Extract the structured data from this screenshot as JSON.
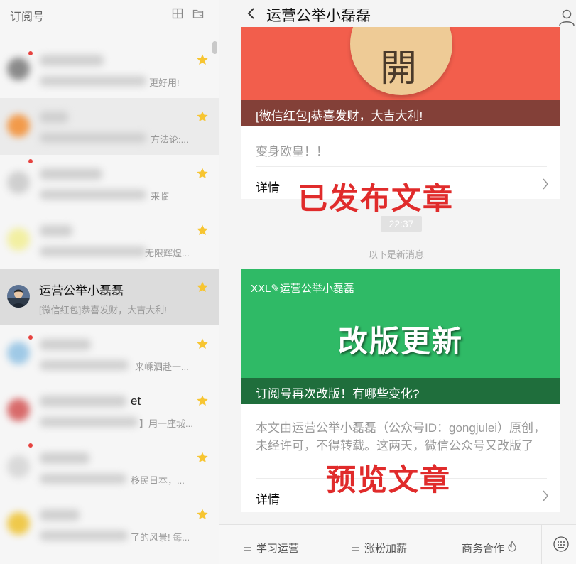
{
  "sidebar": {
    "title": "订阅号",
    "icons": [
      "grid-icon",
      "folder-icon"
    ],
    "items": [
      {
        "preview_tail": "更好用!"
      },
      {
        "preview_tail": "方法论:..."
      },
      {
        "preview_tail": "来临"
      },
      {
        "preview_tail": "无限辉煌..."
      },
      {
        "name": "运营公举小磊磊",
        "preview": "[微信红包]恭喜发财，大吉大利!"
      },
      {
        "preview_tail": "来嵊泗赴一..."
      },
      {
        "name_tail": "et",
        "preview_tail": "】用一座城..."
      },
      {
        "preview_tail": "移民日本，..."
      },
      {
        "preview_tail": "了的风景! 每..."
      }
    ]
  },
  "chat": {
    "title": "运营公举小磊磊",
    "card1": {
      "coin_text": "開",
      "caption": "[微信红包]恭喜发财，大吉大利!",
      "body": "变身欧皇！！",
      "detail": "详情"
    },
    "overlay_published": "已发布文章",
    "time": "22:37",
    "new_messages": "以下是新消息",
    "card2": {
      "brand": "XXL✎运营公举小磊磊",
      "headline": "改版更新",
      "caption": "订阅号再次改版！有哪些变化?",
      "summary": "本文由运营公举小磊磊（公众号ID：gongjulei）原创，未经许可，不得转载。这两天，微信公众号又改版了",
      "detail": "详情"
    },
    "overlay_preview": "预览文章",
    "menus": [
      "学习运营",
      "涨粉加薪",
      "商务合作"
    ],
    "colors": {
      "red_banner": "#f25e4c",
      "green_banner": "#2fba66",
      "star": "#f7c531",
      "overlay": "#e02b2b"
    }
  }
}
